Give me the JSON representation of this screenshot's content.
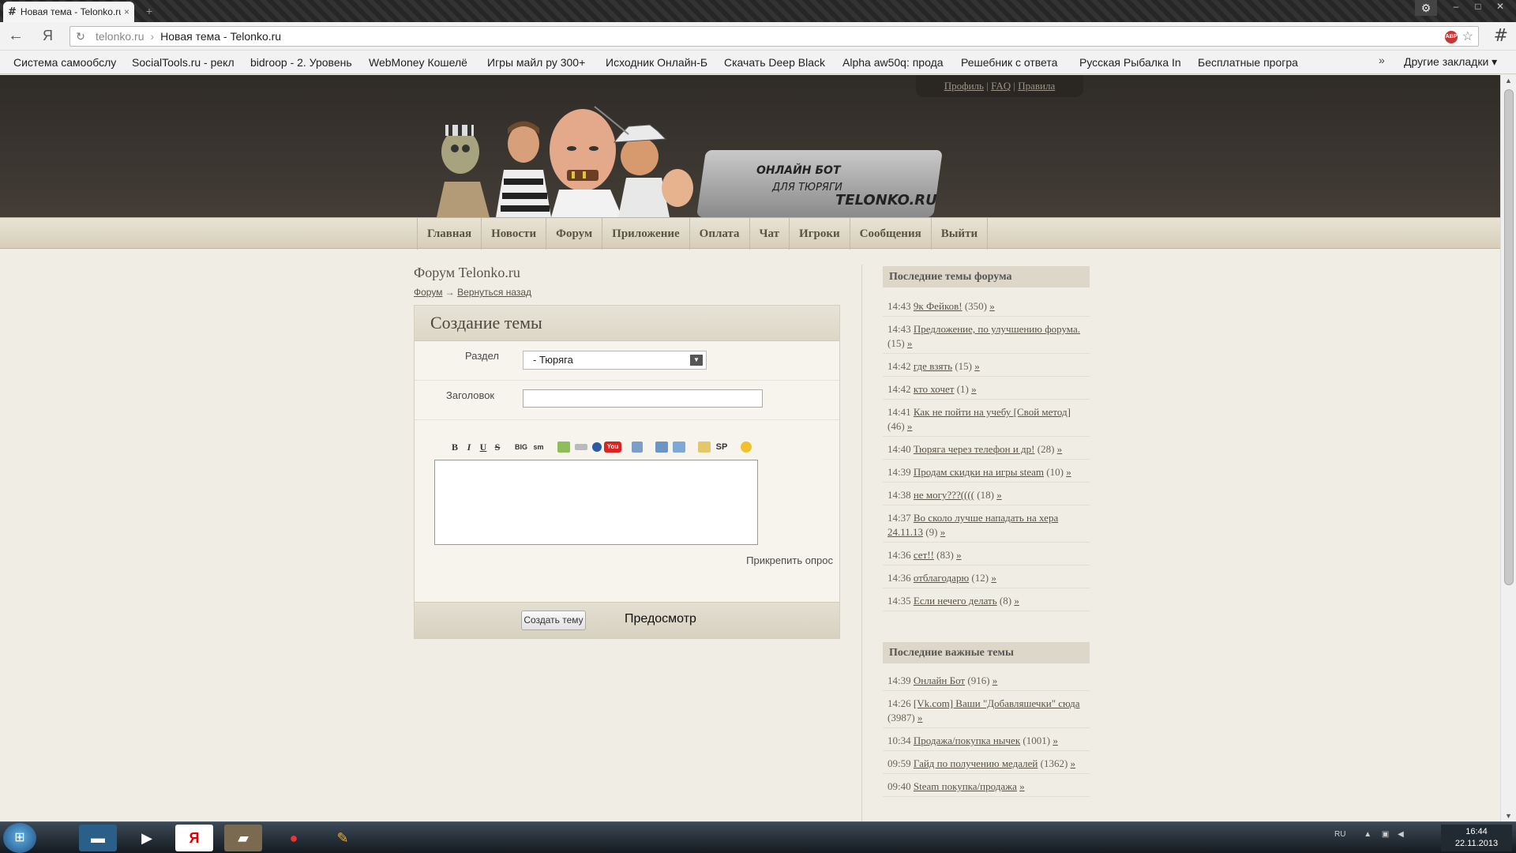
{
  "browser": {
    "tab_title": "Новая тема - Telonko.ru",
    "tab_close": "×",
    "new_tab": "+",
    "address_domain": "telonko.ru",
    "address_sep": "›",
    "address_title": "Новая тема - Telonko.ru",
    "back_icon": "←",
    "yandex_icon": "Я",
    "bookmarks": [
      "Система самообслу",
      "SocialTools.ru - рекл",
      "bidroop - 2. Уровень",
      "WebMoney Кошелё",
      "Игры майл ру 300+",
      "Исходник Онлайн-Б",
      "Скачать Deep Black",
      "Alpha aw50q: прода",
      "Решебник с ответа",
      "Русская Рыбалка In",
      "Бесплатные програ"
    ],
    "bookmarks_more": "»",
    "other_bookmarks": "Другие закладки ▾"
  },
  "site": {
    "top_links": [
      "Профиль",
      "FAQ",
      "Правила"
    ],
    "logo": {
      "line1": "ОНЛАЙН БОТ",
      "line2": "ДЛЯ ТЮРЯГИ",
      "line3": "TELONKO.RU"
    },
    "nav": [
      "Главная",
      "Новости",
      "Форум",
      "Приложение",
      "Оплата",
      "Чат",
      "Игроки",
      "Сообщения",
      "Выйти"
    ]
  },
  "main": {
    "page_title": "Форум Telonko.ru",
    "crumb_forum": "Форум",
    "crumb_arrow": "→",
    "crumb_back": "Вернуться назад",
    "form_title": "Создание темы",
    "section_label": "Раздел",
    "section_value": "- Тюряга",
    "title_label": "Заголовок",
    "toolbar": {
      "bold": "B",
      "italic": "I",
      "underline": "U",
      "strike": "S",
      "big": "BIG",
      "sm": "sm",
      "sp": "SP",
      "youtube": "You"
    },
    "attach_poll": "Прикрепить опрос",
    "create_button": "Создать тему",
    "preview_button": "Предосмотр"
  },
  "sidebar": {
    "latest_title": "Последние темы форума",
    "latest": [
      {
        "time": "14:43",
        "title": "9к Фейков!",
        "count": "(350)"
      },
      {
        "time": "14:43",
        "title": "Предложение, по улучшению форума.",
        "count": "(15)"
      },
      {
        "time": "14:42",
        "title": "где взять",
        "count": "(15)"
      },
      {
        "time": "14:42",
        "title": "кто хочет",
        "count": "(1)"
      },
      {
        "time": "14:41",
        "title": "Как не пойти на учебу [Свой метод]",
        "count": "(46)"
      },
      {
        "time": "14:40",
        "title": "Тюряга через телефон и др!",
        "count": "(28)"
      },
      {
        "time": "14:39",
        "title": "Продам скидки на игры steam",
        "count": "(10)"
      },
      {
        "time": "14:38",
        "title": "не могу???((((",
        "count": "(18)"
      },
      {
        "time": "14:37",
        "title": "Во сколо лучше нападать на хера 24.11.13",
        "count": "(9)"
      },
      {
        "time": "14:36",
        "title": "сет!!",
        "count": "(83)"
      },
      {
        "time": "14:36",
        "title": "отблагодарю",
        "count": "(12)"
      },
      {
        "time": "14:35",
        "title": "Если нечего делать",
        "count": "(8)"
      }
    ],
    "important_title": "Последние важные темы",
    "important": [
      {
        "time": "14:39",
        "title": "Онлайн Бот",
        "count": "(916)"
      },
      {
        "time": "14:26",
        "title": "[Vk.com] Ваши \"Добавляшечки\" сюда",
        "count": "(3987)"
      },
      {
        "time": "10:34",
        "title": "Продажа/покупка нычек",
        "count": "(1001)"
      },
      {
        "time": "09:59",
        "title": "Гайд по получению медалей",
        "count": "(1362)"
      },
      {
        "time": "09:40",
        "title": "Steam покупка/продажа",
        "count": ""
      }
    ],
    "more_link": "»"
  },
  "taskbar": {
    "lang": "RU",
    "time": "16:44",
    "date": "22.11.2013"
  },
  "colors": {
    "header_bg": "#3a3631",
    "nav_bg": "#e0d9c7",
    "page_bg": "#efede4",
    "accent_text": "#5a5346"
  }
}
